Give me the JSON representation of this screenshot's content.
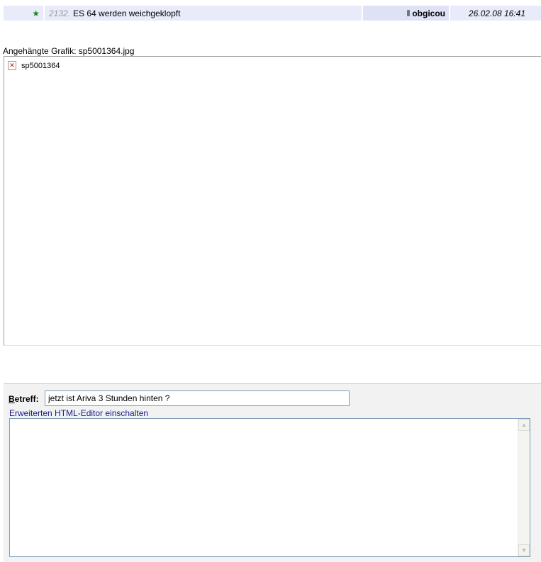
{
  "thread_row": {
    "star_icon": "star-icon",
    "post_number": "2132.",
    "title": "ES 64 werden weichgeklopft",
    "username": "obgicou",
    "datetime": "26.02.08 16:41"
  },
  "attachment": {
    "label": "Angehängte Grafik: sp5001364.jpg",
    "broken_image_alt": "sp5001364"
  },
  "reply_form": {
    "subject_label_accel": "B",
    "subject_label_rest": "etreff:",
    "subject_value": "jetzt ist Ariva 3 Stunden hinten ?",
    "editor_link": "Erweiterten HTML-Editor einschalten",
    "message_value": ""
  },
  "colors": {
    "row_bg": "#e9ebfa",
    "user_cell_bg": "#dfe2f6",
    "star": "#1a8a1a",
    "link": "#1a1a8c"
  }
}
